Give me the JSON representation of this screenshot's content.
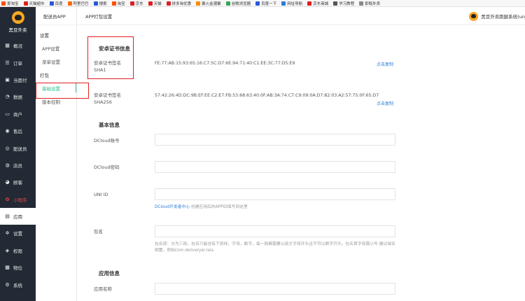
{
  "bookmarks": [
    {
      "label": "爱淘宝",
      "color": "#ff5000"
    },
    {
      "label": "天猫超市",
      "color": "#e02020"
    },
    {
      "label": "百度",
      "color": "#2b58d8"
    },
    {
      "label": "阿里巴巴",
      "color": "#ff6a00"
    },
    {
      "label": "搜索",
      "color": "#2b58d8"
    },
    {
      "label": "淘宝",
      "color": "#ff5000"
    },
    {
      "label": "京东",
      "color": "#e02020"
    },
    {
      "label": "天猫",
      "color": "#e02020"
    },
    {
      "label": "拼多淘优惠",
      "color": "#e02020"
    },
    {
      "label": "聚火金潮聚",
      "color": "#ff8a00"
    },
    {
      "label": "谷歌浏览器",
      "color": "#34a853"
    },
    {
      "label": "百度一下",
      "color": "#2b58d8"
    },
    {
      "label": "网址导航",
      "color": "#2b7dd8"
    },
    {
      "label": "京东商城",
      "color": "#e02020"
    },
    {
      "label": "学习教程",
      "color": "#555555"
    },
    {
      "label": "即既外卖",
      "color": "#888888"
    }
  ],
  "sidebar": {
    "brand": "黑豆外卖",
    "items": [
      {
        "label": "概况",
        "icon": "grid-icon",
        "glyph": "▦"
      },
      {
        "label": "订单",
        "icon": "list-icon",
        "glyph": "☰"
      },
      {
        "label": "当面付",
        "icon": "pay-icon",
        "glyph": "▣"
      },
      {
        "label": "数据",
        "icon": "chart-icon",
        "glyph": "◔"
      },
      {
        "label": "商户",
        "icon": "store-icon",
        "glyph": "▭"
      },
      {
        "label": "售后",
        "icon": "service-icon",
        "glyph": "◉"
      },
      {
        "label": "配送员",
        "icon": "courier-icon",
        "glyph": "◎"
      },
      {
        "label": "店员",
        "icon": "staff-icon",
        "glyph": "◍"
      },
      {
        "label": "顾客",
        "icon": "customer-icon",
        "glyph": "◕"
      },
      {
        "label": "小程序",
        "icon": "miniapp-icon",
        "glyph": "✿"
      },
      {
        "label": "应用",
        "icon": "apps-icon",
        "glyph": "▤"
      },
      {
        "label": "设置",
        "icon": "gear-icon",
        "glyph": "✲"
      },
      {
        "label": "权限",
        "icon": "shield-icon",
        "glyph": "◈"
      },
      {
        "label": "物位",
        "icon": "box-icon",
        "glyph": "▩"
      },
      {
        "label": "系统",
        "icon": "system-icon",
        "glyph": "⚙"
      }
    ]
  },
  "subnav": {
    "title": "配送员APP",
    "group_settings": "设置",
    "item_app_settings": "APP设置",
    "item_menu_settings": "菜单设置",
    "group_package": "打包",
    "item_basic_settings": "基础设置",
    "item_version_control": "版本控制"
  },
  "header": {
    "title": "APP打包设置",
    "user": "黑豆外卖跑腿系统(un"
  },
  "content": {
    "android_cert_title": "安卓证书信息",
    "sha1_label_line1": "安卓证书签名",
    "sha1_label_line2": "SHA1",
    "sha1_value": "FE:77:AB:15:93:65:16:C7:5C:D7:6E:94:71:40:C1:EE:3C:77:D5:E9",
    "sha256_label_line1": "安卓证书签名",
    "sha256_label_line2": "SHA256",
    "sha256_value": "57:42:26:4D:DC:9B:EF:EE:C2:E7:FB:53:68:63:40:0F:AB:3A:74:C7:C9:09:0A:D7:82:03:A2:57:75:0F:65:D7",
    "copy_label": "点击复制",
    "basic_info_title": "基本信息",
    "dcloud_account_label": "DCloud账号",
    "dcloud_password_label": "DCloud密码",
    "uni_id_label": "UNI ID",
    "uni_id_hint_link": "DCloud开发者中心",
    "uni_id_hint_text": " 创建应用后的APPID填写到这里",
    "package_label": "包名",
    "package_hint": "包名按：分为三段。包名只能含有下划线，字母，数字，每一段都需要以英文字母开头且不可以数字开头。包名首字母需小写 建议域名倒置，例如com.deliveryer.lala",
    "app_info_title": "应用信息",
    "app_name_label": "应用名称"
  }
}
